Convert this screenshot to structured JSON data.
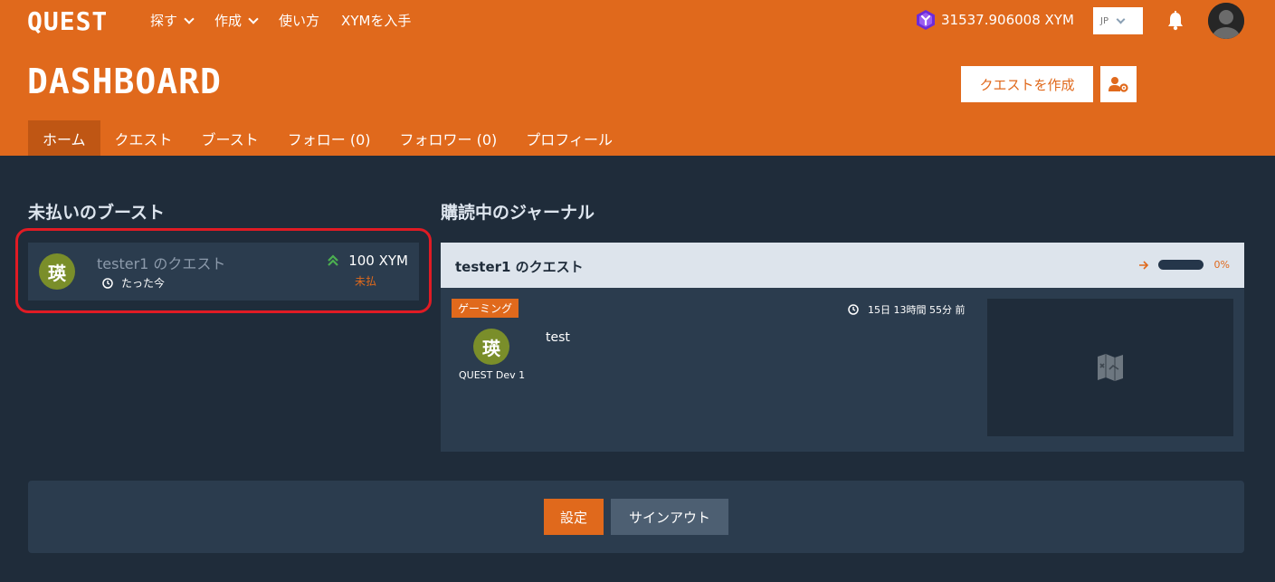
{
  "app": {
    "logo": "QUEST"
  },
  "nav": [
    {
      "label": "探す",
      "dropdown": true
    },
    {
      "label": "作成",
      "dropdown": true
    },
    {
      "label": "使い方",
      "dropdown": false
    },
    {
      "label": "XYMを入手",
      "dropdown": false
    }
  ],
  "header": {
    "balance": "31537.906008 XYM",
    "balance_icon": "symbol-logo-icon",
    "language": "JP",
    "notification_icon": "bell-icon"
  },
  "dashboard": {
    "title": "DASHBOARD",
    "create_quest_label": "クエストを作成",
    "user_settings_icon": "user-gear-icon"
  },
  "tabs": [
    {
      "label": "ホーム",
      "active": true
    },
    {
      "label": "クエスト",
      "active": false
    },
    {
      "label": "ブースト",
      "active": false
    },
    {
      "label": "フォロー (0)",
      "active": false
    },
    {
      "label": "フォロワー (0)",
      "active": false
    },
    {
      "label": "プロフィール",
      "active": false
    }
  ],
  "unpaid_boosts": {
    "title": "未払いのブースト",
    "items": [
      {
        "avatar": "瑛",
        "name": "tester1 のクエスト",
        "time": "たった今",
        "amount": "100 XYM",
        "status": "未払"
      }
    ]
  },
  "journals": {
    "title": "購読中のジャーナル",
    "items": [
      {
        "title": "tester1 のクエスト",
        "progress_label": "0%",
        "progress": 0,
        "category": "ゲーミング",
        "time": "15日 13時間 55分 前",
        "avatar": "瑛",
        "author": "QUEST Dev 1",
        "text": "test",
        "thumbnail_icon": "treasure-map-icon"
      }
    ]
  },
  "footer": {
    "settings_label": "設定",
    "signout_label": "サインアウト"
  },
  "colors": {
    "accent": "#e0691c",
    "background": "#1f2c3a",
    "card": "#2b3c4e",
    "highlight": "#e01b24",
    "boost_arrow": "#4caf50"
  }
}
